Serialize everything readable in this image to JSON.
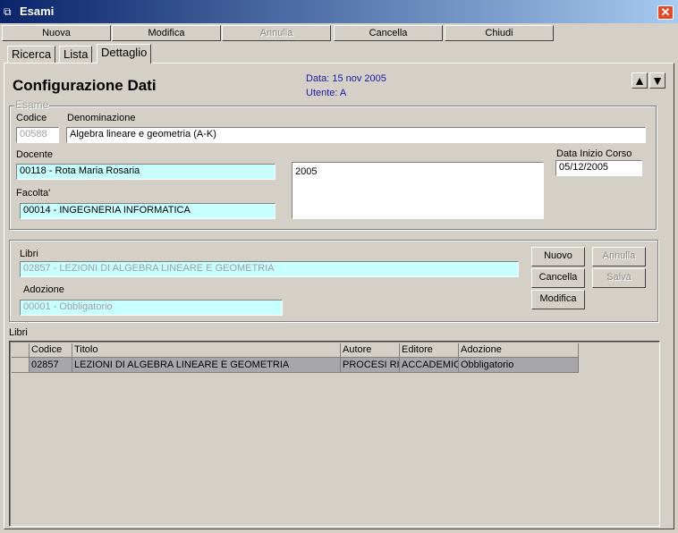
{
  "window": {
    "title": "Esami",
    "close_glyph": "✕"
  },
  "toolbar": {
    "nuova": "Nuova",
    "modifica": "Modifica",
    "annulla": "Annulla",
    "cancella": "Cancella",
    "chiudi": "Chiudi"
  },
  "tabs": [
    "Ricerca",
    "Lista",
    "Dettaglio"
  ],
  "header": {
    "title": "Configurazione Dati",
    "data": "Data: 15 nov 2005",
    "utente": "Utente: A",
    "up_glyph": "▲",
    "down_glyph": "▼"
  },
  "esame": {
    "group_title": "Esame",
    "codice_label": "Codice",
    "codice_value": "00588",
    "denominazione_label": "Denominazione",
    "denominazione_value": "Algebra lineare e geometria (A-K)",
    "docente_label": "Docente",
    "docente_value": "00118 - Rota Maria Rosaria",
    "facolta_label": "Facolta'",
    "facolta_value": "00014 - INGEGNERIA INFORMATICA",
    "anno_value": "2005",
    "data_inizio_label": "Data Inizio Corso",
    "data_inizio_value": "05/12/2005"
  },
  "libri_form": {
    "libri_label": "Libri",
    "libri_value": "02857 - LEZIONI DI ALGEBRA LINEARE E GEOMETRIA",
    "adozione_label": "Adozione",
    "adozione_value": "00001 - Obbligatorio",
    "nuovo": "Nuovo",
    "annulla": "Annulla",
    "cancella": "Cancella",
    "salva": "Salva",
    "modifica": "Modifica"
  },
  "grid": {
    "label": "Libri",
    "columns": [
      "Codice",
      "Titolo",
      "Autore",
      "Editore",
      "Adozione"
    ],
    "rows": [
      [
        "02857",
        "LEZIONI DI ALGEBRA LINEARE E GEOMETRIA",
        "PROCESI RI",
        "ACCADEMIC",
        "Obbligatorio"
      ]
    ]
  },
  "icons": {
    "app": "window-icon",
    "close": "close-icon"
  }
}
